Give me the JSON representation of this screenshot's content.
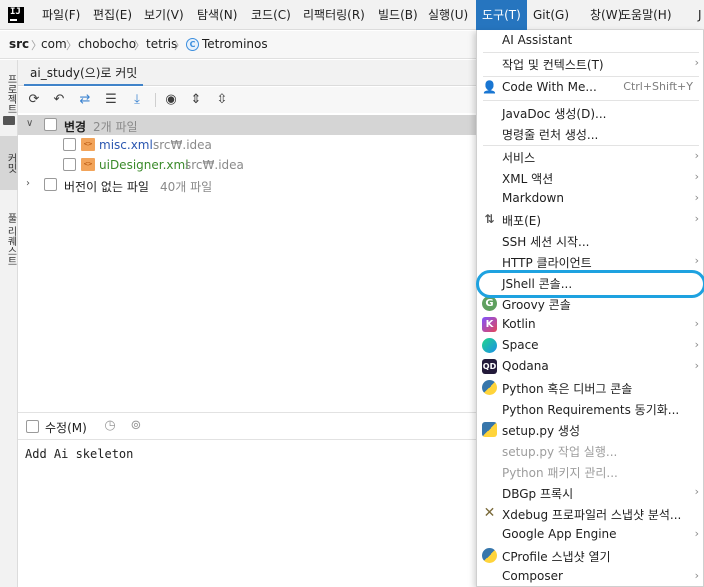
{
  "menubar": {
    "logo": "IJ",
    "items": [
      "파일(F)",
      "편집(E)",
      "보기(V)",
      "탐색(N)",
      "코드(C)",
      "리팩터링(R)",
      "빌드(B)",
      "실행(U)",
      "도구(T)",
      "Git(G)",
      "창(W)",
      "도움말(H)",
      "J"
    ]
  },
  "breadcrumb": {
    "items": [
      "src",
      "com",
      "chobocho",
      "tetris",
      "Tetrominos"
    ],
    "class_icon": "C"
  },
  "tool_stripe": {
    "tabs": [
      "프로젝트",
      "커밋",
      "풀 리퀘스트"
    ]
  },
  "commit_panel": {
    "tab_label": "ai_study(으)로 커밋",
    "tree": {
      "changes_label": "변경",
      "changes_count": "2개 파일",
      "files": [
        {
          "name": "misc.xml",
          "path": "src₩.idea",
          "icon": "xml-file-icon"
        },
        {
          "name": "uiDesigner.xml",
          "path": "src₩.idea",
          "icon": "xml-file-icon"
        }
      ],
      "unversioned_label": "버전이 없는 파일",
      "unversioned_count": "40개 파일"
    },
    "amend_label": "수정(M)",
    "commit_message": "Add Ai skeleton"
  },
  "tools_menu": {
    "items": [
      {
        "label": "AI Assistant"
      },
      {
        "label": "작업 및 컨텍스트(T)",
        "arrow": "›"
      },
      {
        "label": "Code With Me...",
        "shortcut": "Ctrl+Shift+Y",
        "icon": "user-icon"
      },
      {
        "label": "JavaDoc 생성(D)..."
      },
      {
        "label": "명령줄 런처 생성..."
      },
      {
        "label": "서비스",
        "arrow": "›"
      },
      {
        "label": "XML 액션",
        "arrow": "›"
      },
      {
        "label": "Markdown",
        "arrow": "›"
      },
      {
        "label": "배포(E)",
        "arrow": "›",
        "icon": "deploy-icon"
      },
      {
        "label": "SSH 세션 시작..."
      },
      {
        "label": "HTTP 클라이언트",
        "arrow": "›"
      },
      {
        "label": "JShell 콘솔..."
      },
      {
        "label": "Groovy 콘솔",
        "icon": "groovy-icon"
      },
      {
        "label": "Kotlin",
        "arrow": "›",
        "icon": "kotlin-icon"
      },
      {
        "label": "Space",
        "arrow": "›",
        "icon": "space-icon"
      },
      {
        "label": "Qodana",
        "arrow": "›",
        "icon": "qodana-icon"
      },
      {
        "label": "Python 혹은 디버그 콘솔",
        "icon": "python-icon"
      },
      {
        "label": "Python Requirements 동기화..."
      },
      {
        "label": "setup.py 생성",
        "icon": "setup-py-icon"
      },
      {
        "label": "setup.py 작업 실행...",
        "disabled": true
      },
      {
        "label": "Python 패키지 관리...",
        "disabled": true
      },
      {
        "label": "DBGp 프록시",
        "arrow": "›"
      },
      {
        "label": "Xdebug 프로파일러 스냅샷 분석...",
        "icon": "xdebug-icon"
      },
      {
        "label": "Google App Engine",
        "arrow": "›"
      },
      {
        "label": "CProfile 스냅샷 열기",
        "icon": "cprofile-icon"
      },
      {
        "label": "Composer",
        "arrow": "›"
      }
    ]
  },
  "colors": {
    "menu_active": "#2675bf",
    "highlight_oval": "#1ea2e0",
    "selected_row": "#d5d5d5"
  }
}
